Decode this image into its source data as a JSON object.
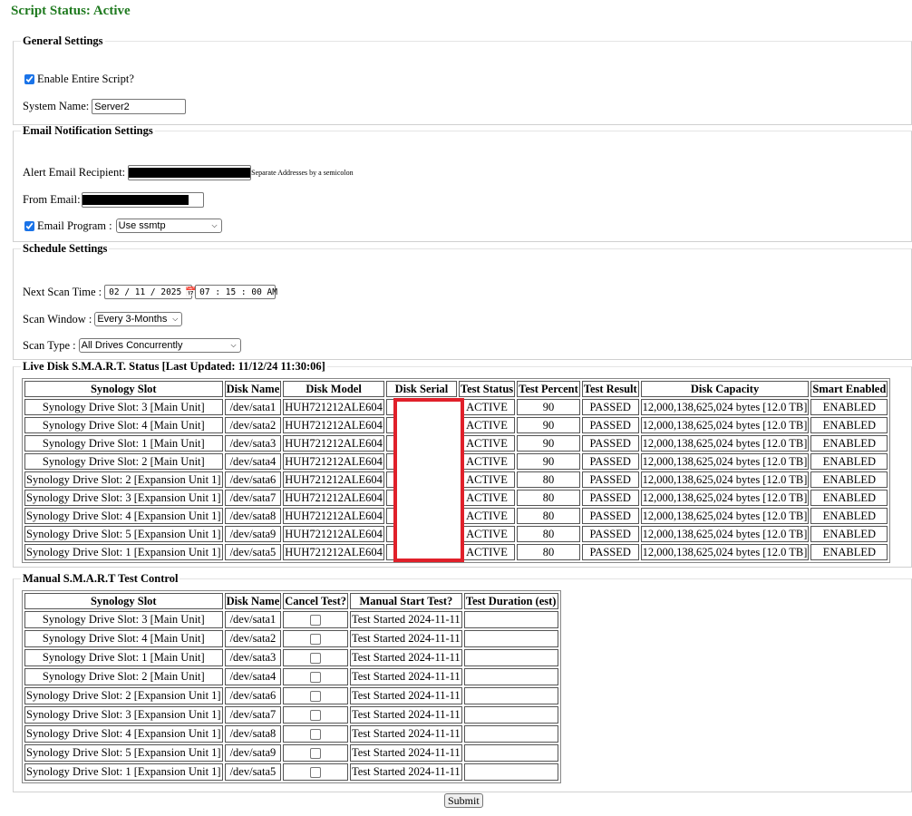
{
  "status": "Script Status: Active",
  "general": {
    "legend": "General Settings",
    "enable_label": "Enable Entire Script?",
    "enable_checked": true,
    "system_name_label": "System Name:",
    "system_name_value": "Server2"
  },
  "email": {
    "legend": "Email Notification Settings",
    "recipient_label": "Alert Email Recipient:",
    "recipient_note": "Separate Addresses by a semicolon",
    "from_label": "From Email:",
    "program_label": "Email Program :",
    "program_checked": true,
    "program_value": "Use ssmtp"
  },
  "schedule": {
    "legend": "Schedule Settings",
    "next_scan_label": "Next Scan Time :",
    "date_value": "02 / 11 / 2025",
    "time_value": "07 : 15 : 00  AM",
    "window_label": "Scan Window :",
    "window_value": "Every 3-Months",
    "type_label": "Scan Type :",
    "type_value": "All Drives Concurrently"
  },
  "live": {
    "legend": "Live Disk S.M.A.R.T. Status [Last Updated: 11/12/24 11:30:06]",
    "headers": [
      "Synology Slot",
      "Disk Name",
      "Disk Model",
      "Disk Serial",
      "Test Status",
      "Test Percent",
      "Test Result",
      "Disk Capacity",
      "Smart Enabled"
    ],
    "rows": [
      [
        "Synology Drive Slot: 3 [Main Unit]",
        "/dev/sata1",
        "HUH721212ALE604",
        "",
        "ACTIVE",
        "90",
        "PASSED",
        "12,000,138,625,024 bytes [12.0 TB]",
        "ENABLED"
      ],
      [
        "Synology Drive Slot: 4 [Main Unit]",
        "/dev/sata2",
        "HUH721212ALE604",
        "",
        "ACTIVE",
        "90",
        "PASSED",
        "12,000,138,625,024 bytes [12.0 TB]",
        "ENABLED"
      ],
      [
        "Synology Drive Slot: 1 [Main Unit]",
        "/dev/sata3",
        "HUH721212ALE604",
        "",
        "ACTIVE",
        "90",
        "PASSED",
        "12,000,138,625,024 bytes [12.0 TB]",
        "ENABLED"
      ],
      [
        "Synology Drive Slot: 2 [Main Unit]",
        "/dev/sata4",
        "HUH721212ALE604",
        "",
        "ACTIVE",
        "90",
        "PASSED",
        "12,000,138,625,024 bytes [12.0 TB]",
        "ENABLED"
      ],
      [
        "Synology Drive Slot: 2 [Expansion Unit 1]",
        "/dev/sata6",
        "HUH721212ALE604",
        "",
        "ACTIVE",
        "80",
        "PASSED",
        "12,000,138,625,024 bytes [12.0 TB]",
        "ENABLED"
      ],
      [
        "Synology Drive Slot: 3 [Expansion Unit 1]",
        "/dev/sata7",
        "HUH721212ALE604",
        "",
        "ACTIVE",
        "80",
        "PASSED",
        "12,000,138,625,024 bytes [12.0 TB]",
        "ENABLED"
      ],
      [
        "Synology Drive Slot: 4 [Expansion Unit 1]",
        "/dev/sata8",
        "HUH721212ALE604",
        "",
        "ACTIVE",
        "80",
        "PASSED",
        "12,000,138,625,024 bytes [12.0 TB]",
        "ENABLED"
      ],
      [
        "Synology Drive Slot: 5 [Expansion Unit 1]",
        "/dev/sata9",
        "HUH721212ALE604",
        "",
        "ACTIVE",
        "80",
        "PASSED",
        "12,000,138,625,024 bytes [12.0 TB]",
        "ENABLED"
      ],
      [
        "Synology Drive Slot: 1 [Expansion Unit 1]",
        "/dev/sata5",
        "HUH721212ALE604",
        "",
        "ACTIVE",
        "80",
        "PASSED",
        "12,000,138,625,024 bytes [12.0 TB]",
        "ENABLED"
      ]
    ]
  },
  "manual": {
    "legend": "Manual S.M.A.R.T Test Control",
    "headers": [
      "Synology Slot",
      "Disk Name",
      "Cancel Test?",
      "Manual Start Test?",
      "Test Duration (est)"
    ],
    "rows": [
      [
        "Synology Drive Slot: 3 [Main Unit]",
        "/dev/sata1",
        "Test Started 2024-11-11"
      ],
      [
        "Synology Drive Slot: 4 [Main Unit]",
        "/dev/sata2",
        "Test Started 2024-11-11"
      ],
      [
        "Synology Drive Slot: 1 [Main Unit]",
        "/dev/sata3",
        "Test Started 2024-11-11"
      ],
      [
        "Synology Drive Slot: 2 [Main Unit]",
        "/dev/sata4",
        "Test Started 2024-11-11"
      ],
      [
        "Synology Drive Slot: 2 [Expansion Unit 1]",
        "/dev/sata6",
        "Test Started 2024-11-11"
      ],
      [
        "Synology Drive Slot: 3 [Expansion Unit 1]",
        "/dev/sata7",
        "Test Started 2024-11-11"
      ],
      [
        "Synology Drive Slot: 4 [Expansion Unit 1]",
        "/dev/sata8",
        "Test Started 2024-11-11"
      ],
      [
        "Synology Drive Slot: 5 [Expansion Unit 1]",
        "/dev/sata9",
        "Test Started 2024-11-11"
      ],
      [
        "Synology Drive Slot: 1 [Expansion Unit 1]",
        "/dev/sata5",
        "Test Started 2024-11-11"
      ]
    ]
  },
  "submit_label": "Submit",
  "colors": {
    "status_green": "#1f7a1f",
    "redaction_box": "#e0202a",
    "checkbox_accent": "#1a73e8"
  }
}
